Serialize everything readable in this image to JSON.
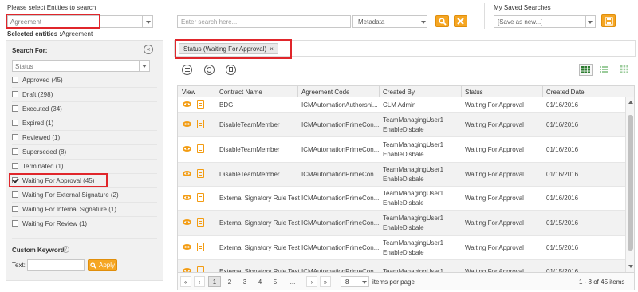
{
  "top": {
    "entity_prompt": "Please select Entities to search",
    "entity_value": "Agreement",
    "selected_label": "Selected entities :",
    "selected_value": "Agreement",
    "search_placeholder": "Enter search here...",
    "search_scope": "Metadata",
    "saved_label": "My Saved Searches",
    "saved_value": "[Save as new...]"
  },
  "sidebar": {
    "title": "Search For:",
    "status_select": "Status",
    "items": [
      {
        "label": "Approved (45)",
        "checked": false
      },
      {
        "label": "Draft (298)",
        "checked": false
      },
      {
        "label": "Executed (34)",
        "checked": false
      },
      {
        "label": "Expired (1)",
        "checked": false
      },
      {
        "label": "Reviewed (1)",
        "checked": false
      },
      {
        "label": "Superseded (8)",
        "checked": false
      },
      {
        "label": "Terminated (1)",
        "checked": false
      },
      {
        "label": "Waiting For Approval (45)",
        "checked": true
      },
      {
        "label": "Waiting For External Signature (2)",
        "checked": false
      },
      {
        "label": "Waiting For Internal Signature (1)",
        "checked": false
      },
      {
        "label": "Waiting For Review (1)",
        "checked": false
      }
    ],
    "custom_keyword": "Custom Keyword",
    "text_label": "Text:",
    "apply_label": "Apply"
  },
  "filter_tag": "Status (Waiting For Approval)",
  "filter_tag_close": "×",
  "table": {
    "headers": [
      "View",
      "Contract Name",
      "Agreement Code",
      "Created By",
      "Status",
      "Created Date"
    ],
    "rows": [
      {
        "name": "BDG",
        "code": "ICMAutomationAuthorshi...",
        "by": [
          "CLM Admin"
        ],
        "status": "Waiting For Approval",
        "date": "01/16/2016"
      },
      {
        "name": "DisableTeamMember",
        "code": "ICMAutomationPrimeCon...",
        "by": [
          "TeamManagingUser1",
          "EnableDisbale"
        ],
        "status": "Waiting For Approval",
        "date": "01/16/2016"
      },
      {
        "name": "DisableTeamMember",
        "code": "ICMAutomationPrimeCon...",
        "by": [
          "TeamManagingUser1",
          "EnableDisbale"
        ],
        "status": "Waiting For Approval",
        "date": "01/16/2016"
      },
      {
        "name": "DisableTeamMember",
        "code": "ICMAutomationPrimeCon...",
        "by": [
          "TeamManagingUser1",
          "EnableDisbale"
        ],
        "status": "Waiting For Approval",
        "date": "01/16/2016"
      },
      {
        "name": "External Signatory Rule Test",
        "code": "ICMAutomationPrimeCon...",
        "by": [
          "TeamManagingUser1",
          "EnableDisbale"
        ],
        "status": "Waiting For Approval",
        "date": "01/16/2016"
      },
      {
        "name": "External Signatory Rule Test",
        "code": "ICMAutomationPrimeCon...",
        "by": [
          "TeamManagingUser1",
          "EnableDisbale"
        ],
        "status": "Waiting For Approval",
        "date": "01/15/2016"
      },
      {
        "name": "External Signatory Rule Test",
        "code": "ICMAutomationPrimeCon...",
        "by": [
          "TeamManagingUser1",
          "EnableDisbale"
        ],
        "status": "Waiting For Approval",
        "date": "01/15/2016"
      },
      {
        "name": "External Signatory Rule Test",
        "code": "ICMAutomationPrimeCon...",
        "by": [
          "TeamManagingUser1"
        ],
        "status": "Waiting For Approval",
        "date": "01/15/2016"
      }
    ]
  },
  "pager": {
    "first": "«",
    "prev": "‹",
    "pages": [
      "1",
      "2",
      "3",
      "4",
      "5",
      "..."
    ],
    "next": "›",
    "last": "»",
    "page_size": "8",
    "per_page_label": "items per page",
    "summary": "1 - 8 of 45 items"
  },
  "colors": {
    "accent": "#f5a623",
    "highlight": "#e0262b",
    "grid_active": "#2e7d32"
  },
  "icons": [
    "search-icon",
    "close-icon",
    "save-icon",
    "collapse-icon",
    "list-icon",
    "refresh-icon",
    "copy-icon",
    "grid-view-icon",
    "list-view-icon",
    "tile-view-icon",
    "eye-icon",
    "note-icon",
    "help-icon"
  ]
}
